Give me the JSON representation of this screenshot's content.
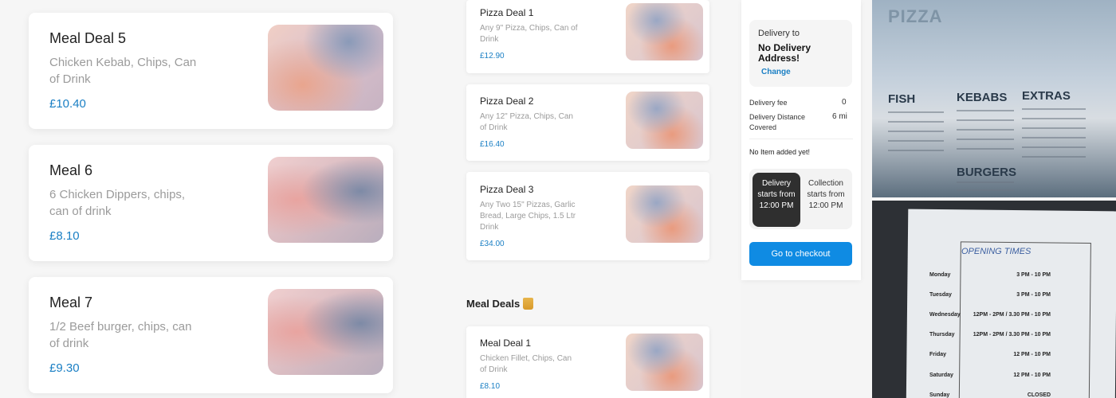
{
  "big_cards": [
    {
      "title": "Meal Deal 5",
      "desc": "Chicken Kebab, Chips, Can of Drink",
      "price": "£10.40"
    },
    {
      "title": "Meal 6",
      "desc": "6 Chicken Dippers, chips, can of drink",
      "price": "£8.10"
    },
    {
      "title": "Meal 7",
      "desc": "1/2 Beef burger, chips, can of drink",
      "price": "£9.30"
    }
  ],
  "pizza_deals": [
    {
      "title": "Pizza Deal 1",
      "desc": "Any 9\" Pizza, Chips, Can of Drink",
      "price": "£12.90"
    },
    {
      "title": "Pizza Deal 2",
      "desc": "Any 12\" Pizza, Chips, Can of Drink",
      "price": "£16.40"
    },
    {
      "title": "Pizza Deal 3",
      "desc": "Any Two 15\" Pizzas, Garlic Bread, Large Chips, 1.5 Ltr Drink",
      "price": "£34.00"
    }
  ],
  "section": {
    "title": "Meal Deals"
  },
  "meal_deal_1": {
    "title": "Meal Deal 1",
    "desc": "Chicken Fillet, Chips, Can of Drink",
    "price": "£8.10"
  },
  "cart": {
    "delivery_to_label": "Delivery to",
    "address": "No Delivery Address!",
    "change_label": "Change",
    "delivery_fee_label": "Delivery fee",
    "delivery_fee_value": "0",
    "distance_label": "Delivery Distance Covered",
    "distance_value": "6 mi",
    "empty_text": "No Item added yet!",
    "delivery_toggle": "Delivery starts from 12:00 PM",
    "collection_toggle": "Collection starts from 12:00 PM",
    "checkout_label": "Go to checkout",
    "accent_color": "#0f8be3"
  },
  "menu_photo": {
    "headers": [
      "PIZZA",
      "FISH",
      "KEBABS",
      "EXTRAS",
      "BURGERS"
    ]
  },
  "hours_photo": {
    "title": "OPENING TIMES",
    "rows": [
      {
        "day": "Monday",
        "hours": "3 PM - 10 PM"
      },
      {
        "day": "Tuesday",
        "hours": "3 PM - 10 PM"
      },
      {
        "day": "Wednesday",
        "hours": "12PM - 2PM / 3.30 PM - 10 PM"
      },
      {
        "day": "Thursday",
        "hours": "12PM - 2PM / 3.30 PM - 10 PM"
      },
      {
        "day": "Friday",
        "hours": "12 PM - 10 PM"
      },
      {
        "day": "Saturday",
        "hours": "12 PM - 10 PM"
      },
      {
        "day": "Sunday",
        "hours": "CLOSED"
      }
    ]
  }
}
